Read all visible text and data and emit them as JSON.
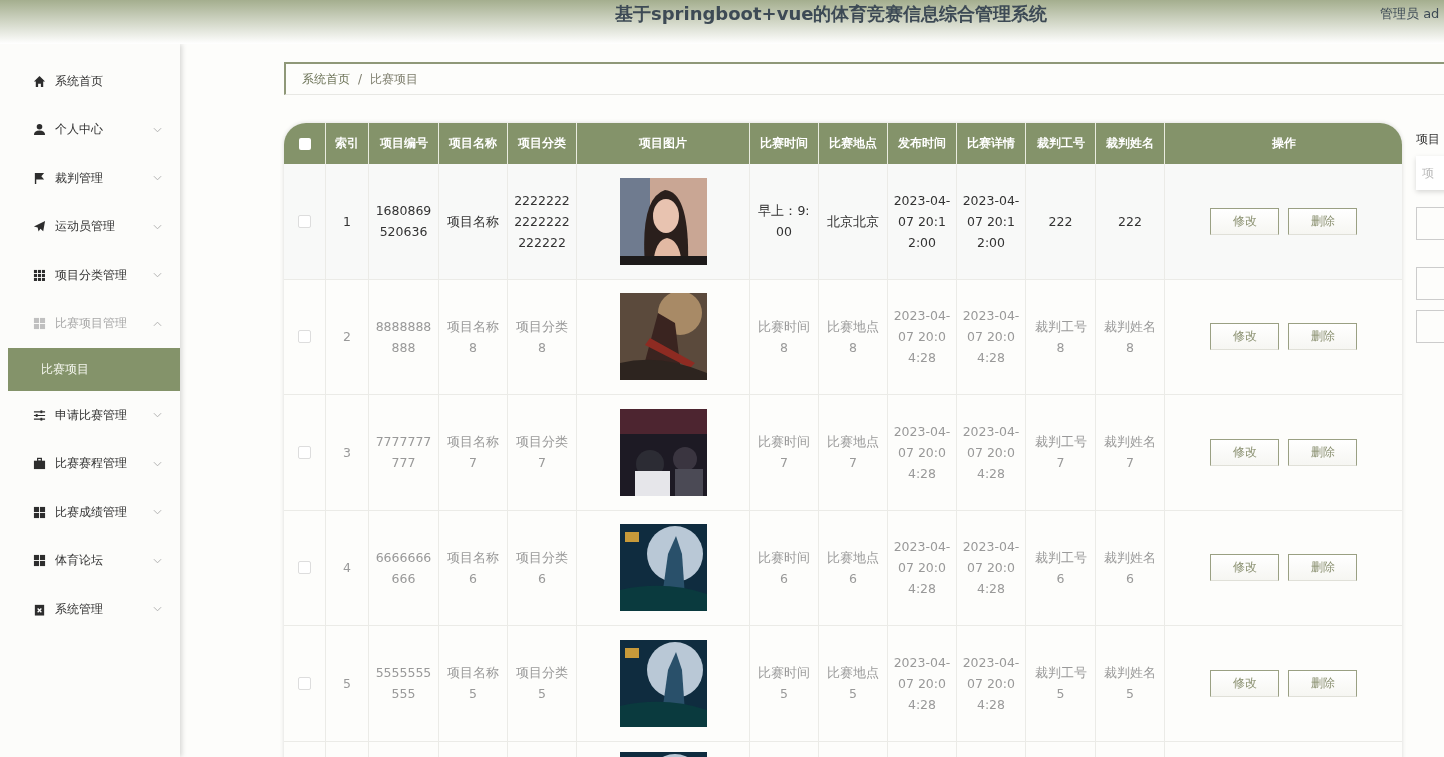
{
  "header": {
    "title": "基于springboot+vue的体育竞赛信息综合管理系统",
    "user": "管理员 ad"
  },
  "sidebar": {
    "items": [
      {
        "label": "系统首页",
        "kind": "link"
      },
      {
        "label": "个人中心",
        "kind": "submenu",
        "expanded": false
      },
      {
        "label": "裁判管理",
        "kind": "submenu",
        "expanded": false
      },
      {
        "label": "运动员管理",
        "kind": "submenu",
        "expanded": false
      },
      {
        "label": "项目分类管理",
        "kind": "submenu",
        "expanded": false
      },
      {
        "label": "比赛项目管理",
        "kind": "submenu",
        "expanded": true,
        "children": [
          {
            "label": "比赛项目",
            "selected": true
          }
        ]
      },
      {
        "label": "申请比赛管理",
        "kind": "submenu",
        "expanded": false
      },
      {
        "label": "比赛赛程管理",
        "kind": "submenu",
        "expanded": false
      },
      {
        "label": "比赛成绩管理",
        "kind": "submenu",
        "expanded": false
      },
      {
        "label": "体育论坛",
        "kind": "submenu",
        "expanded": false
      },
      {
        "label": "系统管理",
        "kind": "submenu",
        "expanded": false
      }
    ]
  },
  "breadcrumb": {
    "separator": "/",
    "items": [
      "系统首页",
      "比赛项目"
    ]
  },
  "table": {
    "select_all": {
      "checked": false
    },
    "columns": [
      "索引",
      "项目编号",
      "项目名称",
      "项目分类",
      "项目图片",
      "比赛时间",
      "比赛地点",
      "发布时间",
      "比赛详情",
      "裁判工号",
      "裁判姓名",
      "操作"
    ],
    "rows": [
      {
        "checked": false,
        "hovered": true,
        "cells": [
          "1",
          "1680869520636",
          "项目名称",
          "22222222222222222222",
          "早上：9:00",
          "北京北京",
          "2023-04-07 20:12:00",
          "2023-04-07 20:12:00",
          "222",
          "222"
        ],
        "actions": [
          "修改",
          "删除"
        ]
      },
      {
        "checked": false,
        "hovered": false,
        "cells": [
          "2",
          "8888888888",
          "项目名称8",
          "项目分类8",
          "比赛时间8",
          "比赛地点8",
          "2023-04-07 20:04:28",
          "2023-04-07 20:04:28",
          "裁判工号8",
          "裁判姓名8"
        ],
        "actions": [
          "修改",
          "删除"
        ]
      },
      {
        "checked": false,
        "hovered": false,
        "cells": [
          "3",
          "7777777777",
          "项目名称7",
          "项目分类7",
          "比赛时间7",
          "比赛地点7",
          "2023-04-07 20:04:28",
          "2023-04-07 20:04:28",
          "裁判工号7",
          "裁判姓名7"
        ],
        "actions": [
          "修改",
          "删除"
        ]
      },
      {
        "checked": false,
        "hovered": false,
        "cells": [
          "4",
          "6666666666",
          "项目名称6",
          "项目分类6",
          "比赛时间6",
          "比赛地点6",
          "2023-04-07 20:04:28",
          "2023-04-07 20:04:28",
          "裁判工号6",
          "裁判姓名6"
        ],
        "actions": [
          "修改",
          "删除"
        ]
      },
      {
        "checked": false,
        "hovered": false,
        "cells": [
          "5",
          "5555555555",
          "项目名称5",
          "项目分类5",
          "比赛时间5",
          "比赛地点5",
          "2023-04-07 20:04:28",
          "2023-04-07 20:04:28",
          "裁判工号5",
          "裁判姓名5"
        ],
        "actions": [
          "修改",
          "删除"
        ]
      },
      {
        "partial": true
      }
    ]
  },
  "search_panel": {
    "label": "项目",
    "placeholder": "项"
  }
}
